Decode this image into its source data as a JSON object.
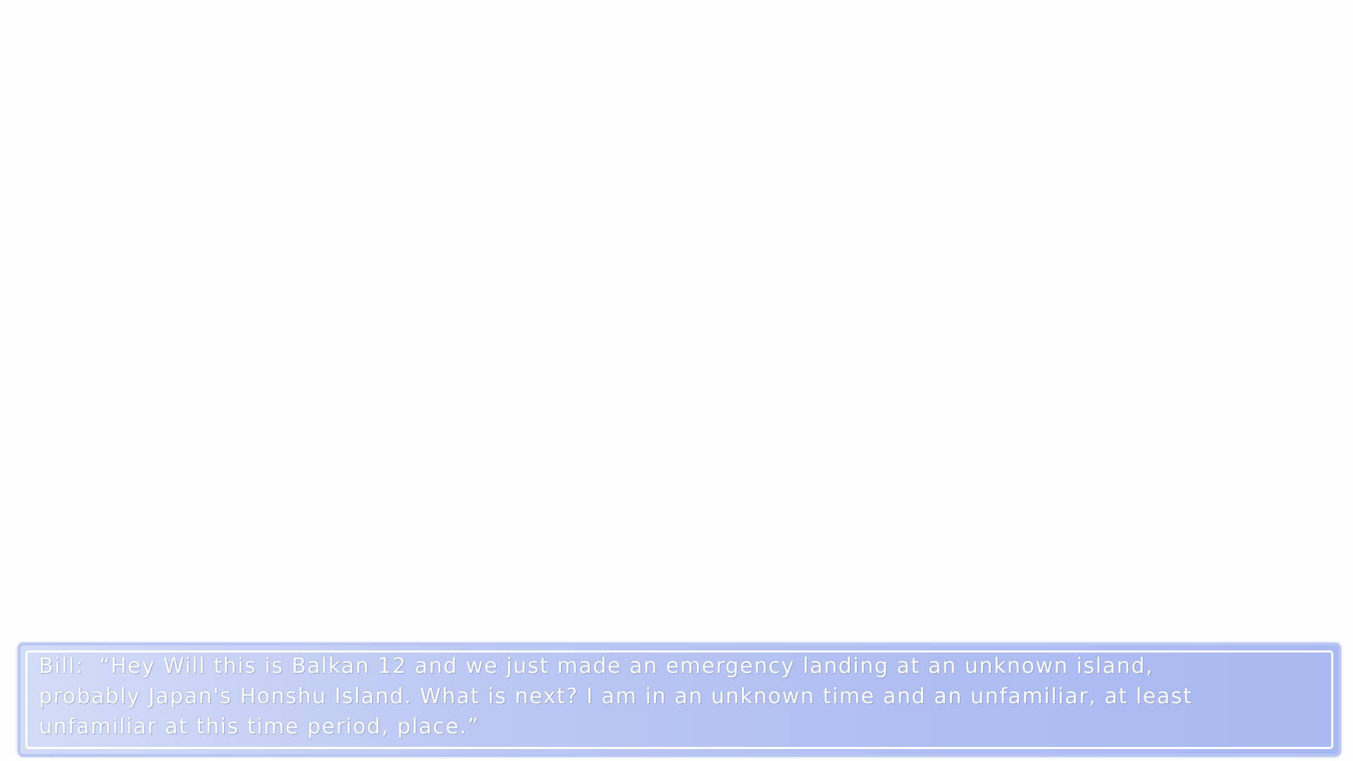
{
  "dialogue": {
    "speaker": "Bill:",
    "text": "“Hey Will this is Balkan 12 and we just made an emergency landing at an unknown island, probably Japan's Honshu Island. What is next? I am in an unknown time and an unfamiliar, at least unfamiliar at this time period, place.”"
  },
  "colors": {
    "box_gradient_start": "#d3dcf7",
    "box_gradient_end": "#a9b9f1",
    "box_border": "#b9c6f3",
    "text": "#ffffff",
    "background": "#fefefe"
  }
}
